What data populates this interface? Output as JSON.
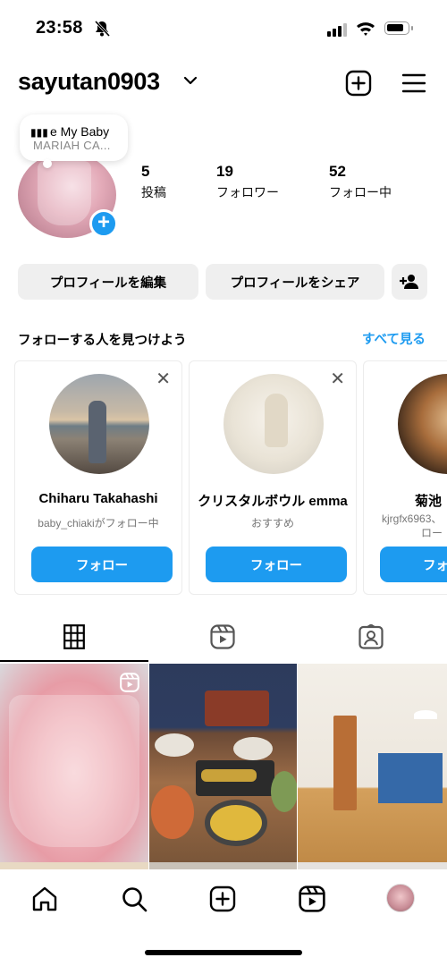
{
  "status_bar": {
    "time": "23:58"
  },
  "header": {
    "username": "sayutan0903"
  },
  "profile": {
    "note": {
      "song": "e My Baby",
      "artist": "MARIAH CA..."
    },
    "stats": [
      {
        "value": "5",
        "label": "投稿"
      },
      {
        "value": "19",
        "label": "フォロワー"
      },
      {
        "value": "52",
        "label": "フォロー中"
      }
    ]
  },
  "actions": {
    "edit_profile": "プロフィールを編集",
    "share_profile": "プロフィールをシェア"
  },
  "suggestions": {
    "title": "フォローする人を見つけよう",
    "see_all": "すべて見る",
    "cards": [
      {
        "name": "Chiharu Takahashi",
        "subtitle": "baby_chiakiがフォロー中",
        "button": "フォロー"
      },
      {
        "name": "クリスタルボウル emma",
        "subtitle": "おすすめ",
        "button": "フォロー"
      },
      {
        "name": "菊池",
        "subtitle": "kjrgfx6963、",
        "subtitle2": "ロー",
        "button": "フォ"
      }
    ]
  },
  "colors": {
    "accent": "#1d9bf0",
    "button_bg": "#efefef"
  },
  "icons": {
    "header": [
      "create-icon",
      "menu-icon"
    ],
    "tabs": [
      "grid-icon",
      "reels-icon",
      "tagged-icon"
    ],
    "nav": [
      "home-icon",
      "search-icon",
      "create-icon",
      "reels-icon",
      "profile-avatar"
    ]
  }
}
